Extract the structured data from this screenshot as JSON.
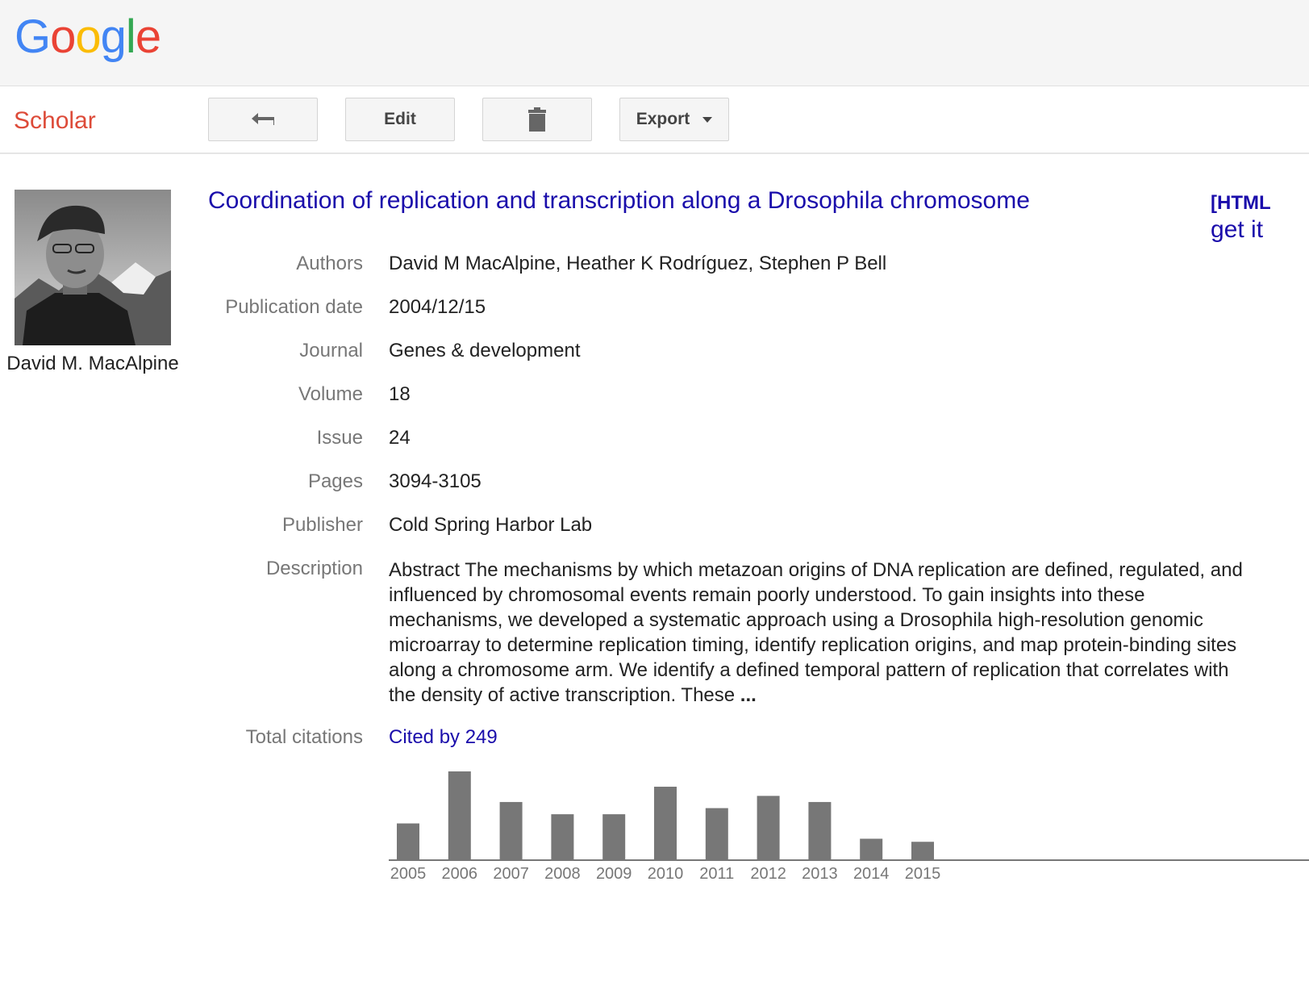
{
  "header": {
    "logo": [
      "G",
      "o",
      "o",
      "g",
      "l",
      "e"
    ],
    "logo_colors": [
      "#4285f4",
      "#ea4335",
      "#fbbc05",
      "#4285f4",
      "#34a853",
      "#ea4335"
    ]
  },
  "toolbar": {
    "section_label": "Scholar",
    "back_icon": "back-arrow-icon",
    "edit_label": "Edit",
    "delete_icon": "trash-icon",
    "export_label": "Export"
  },
  "profile": {
    "name": "David M. MacAlpine"
  },
  "article": {
    "title": "Coordination of replication and transcription along a Drosophila chromosome",
    "side_link_1": "[HTML",
    "side_link_2": "get it"
  },
  "fields": {
    "authors_label": "Authors",
    "authors": "David M MacAlpine, Heather K Rodríguez, Stephen P Bell",
    "date_label": "Publication date",
    "date": "2004/12/15",
    "journal_label": "Journal",
    "journal": "Genes & development",
    "volume_label": "Volume",
    "volume": "18",
    "issue_label": "Issue",
    "issue": "24",
    "pages_label": "Pages",
    "pages": "3094-3105",
    "publisher_label": "Publisher",
    "publisher": "Cold Spring Harbor Lab",
    "description_label": "Description",
    "description": "Abstract The mechanisms by which metazoan origins of DNA replication are defined, regulated, and influenced by chromosomal events remain poorly understood. To gain insights into these mechanisms, we developed a systematic approach using a Drosophila high-resolution genomic microarray to determine replication timing, identify replication origins, and map protein-binding sites along a chromosome arm. We identify a defined temporal pattern of replication that correlates with the density of active transcription. These",
    "description_more": "...",
    "citations_label": "Total citations",
    "citations_link": "Cited by 249"
  },
  "chart_data": {
    "type": "bar",
    "categories": [
      "2005",
      "2006",
      "2007",
      "2008",
      "2009",
      "2010",
      "2011",
      "2012",
      "2013",
      "2014",
      "2015"
    ],
    "values": [
      12,
      29,
      19,
      15,
      15,
      24,
      17,
      21,
      19,
      7,
      6
    ],
    "ylim": [
      0,
      29
    ],
    "bar_color": "#777777",
    "grid": false
  }
}
